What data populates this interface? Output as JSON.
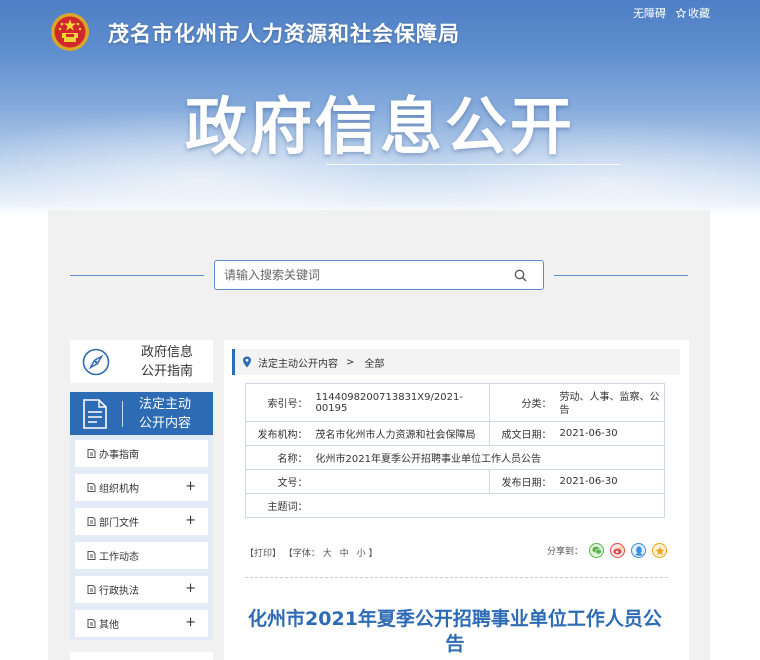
{
  "header": {
    "site_name": "茂名市化州市人力资源和社会保障局",
    "accessibility_link": "无障碍",
    "favorite_link": "收藏",
    "big_title": "政府信息公开"
  },
  "search": {
    "placeholder": "请输入搜索关键词"
  },
  "sidebar": {
    "guide_line1": "政府信息",
    "guide_line2": "公开指南",
    "active_line1": "法定主动",
    "active_line2": "公开内容",
    "items": [
      {
        "label": "办事指南",
        "plus": ""
      },
      {
        "label": "组织机构",
        "plus": "+"
      },
      {
        "label": "部门文件",
        "plus": "+"
      },
      {
        "label": "工作动态",
        "plus": ""
      },
      {
        "label": "行政执法",
        "plus": "+"
      },
      {
        "label": "其他",
        "plus": "+"
      }
    ]
  },
  "breadcrumb": {
    "section": "法定主动公开内容",
    "separator": ">",
    "current": "全部"
  },
  "meta": {
    "index_label": "索引号：",
    "index_value": "114409820071383​1X9/2021-00195",
    "category_label": "分类：",
    "category_value": "劳动、人事、监察、公告",
    "publisher_label": "发布机构：",
    "publisher_value": "茂名市化州市人力资源和社会保障局",
    "created_label": "成文日期：",
    "created_value": "2021-06-30",
    "name_label": "名称：",
    "name_value": "化州市2021年夏季公开招聘事业单位工作人员公告",
    "docno_label": "文号：",
    "docno_value": "",
    "published_label": "发布日期：",
    "published_value": "2021-06-30",
    "keywords_label": "主题词：",
    "keywords_value": ""
  },
  "tools": {
    "print": "【打印】",
    "font_prefix": "【字体：",
    "font_large": "大",
    "font_medium": "中",
    "font_small": "小",
    "font_suffix": "】",
    "share_label": "分享到："
  },
  "article": {
    "title": "化州市2021年夏季公开招聘事业单位工作人员公告"
  },
  "colors": {
    "brand_blue": "#2d6bb5",
    "panel_bg": "#f1f1f1"
  }
}
